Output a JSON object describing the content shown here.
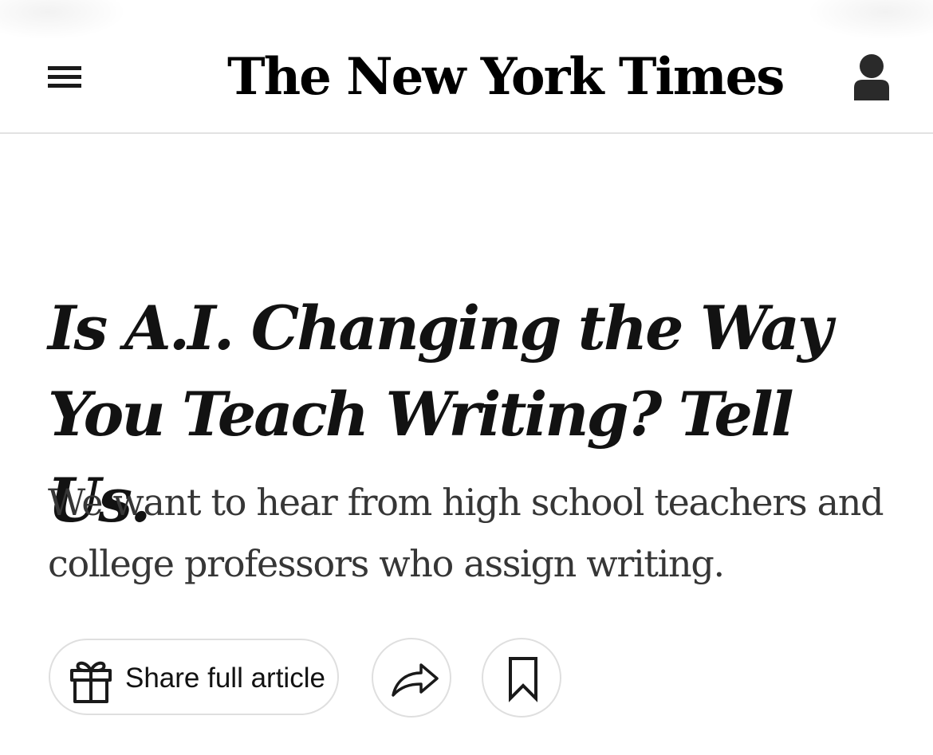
{
  "header": {
    "logo_text": "The New York Times",
    "menu_icon": "hamburger-menu-icon",
    "account_icon": "user-account-icon"
  },
  "article": {
    "headline": "Is A.I. Changing the Way You Teach Writing? Tell Us.",
    "summary": "We want to hear from high school teachers and college professors who assign writing."
  },
  "actions": {
    "share_full_article_label": "Share full article",
    "gift_icon": "gift-icon",
    "share_icon": "share-arrow-icon",
    "save_icon": "bookmark-icon"
  },
  "colors": {
    "text": "#121212",
    "summary_text": "#363636",
    "border": "#dfdfdf",
    "background": "#ffffff"
  }
}
